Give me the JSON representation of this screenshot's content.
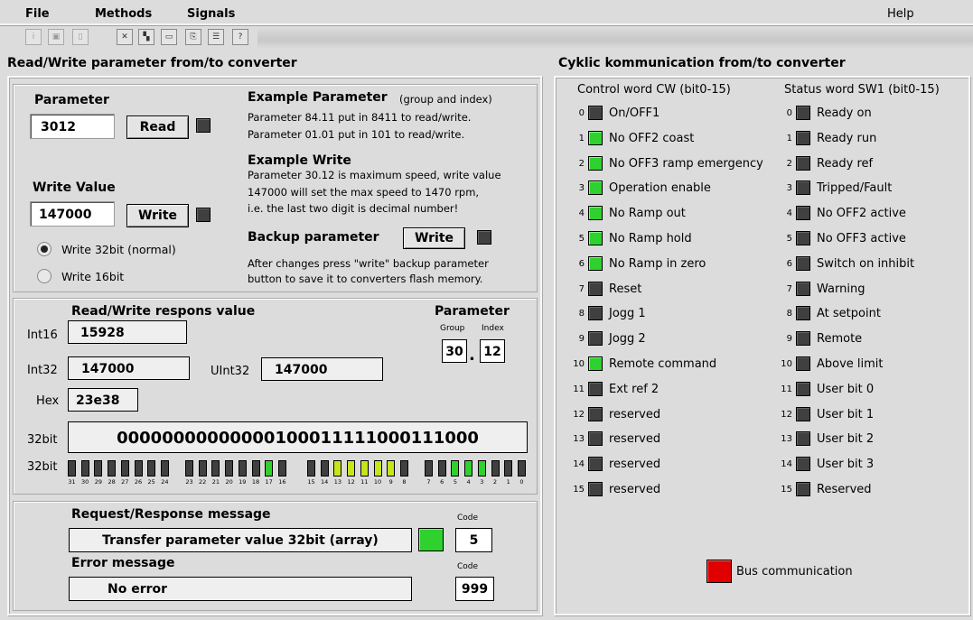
{
  "menu": {
    "file": "File",
    "methods": "Methods",
    "signals": "Signals",
    "help": "Help"
  },
  "toolbar": [
    {
      "icon": "info-icon",
      "glyph": "i"
    },
    {
      "icon": "image-icon",
      "glyph": "▣"
    },
    {
      "icon": "document-icon",
      "glyph": "▯"
    },
    {
      "icon": "cut-icon",
      "glyph": "✕"
    },
    {
      "icon": "block-icon",
      "glyph": "▚"
    },
    {
      "icon": "frame-icon",
      "glyph": "▭"
    },
    {
      "icon": "copy-icon",
      "glyph": "⎘"
    },
    {
      "icon": "list-icon",
      "glyph": "☰"
    },
    {
      "icon": "help-icon",
      "glyph": "?"
    }
  ],
  "left": {
    "title": "Read/Write parameter from/to converter",
    "parameter_label": "Parameter",
    "parameter_value": "3012",
    "read_label": "Read",
    "write_value_label": "Write Value",
    "write_value": "147000",
    "write_label": "Write",
    "radio_32": "Write 32bit (normal)",
    "radio_16": "Write 16bit",
    "example_param_title": "Example Parameter",
    "example_param_sub": "(group and index)",
    "example_param_l1": "Parameter 84.11 put in 8411 to read/write.",
    "example_param_l2": "Parameter 01.01 put in 101 to read/write.",
    "example_write_title": "Example Write",
    "example_write_l1": "Parameter 30.12 is maximum speed, write value",
    "example_write_l2": "147000 will set the max speed to 1470 rpm,",
    "example_write_l3": "i.e. the last two digit is decimal number!",
    "backup_title": "Backup parameter",
    "backup_button": "Write",
    "backup_l1": "After changes press \"write\" backup parameter",
    "backup_l2": "button to save it to converters flash memory."
  },
  "response": {
    "title": "Read/Write respons value",
    "int16_label": "Int16",
    "int16": "15928",
    "int32_label": "Int32",
    "int32": "147000",
    "uint32_label": "UInt32",
    "uint32": "147000",
    "hex_label": "Hex",
    "hex": "23e38",
    "bin_label": "32bit",
    "bin": "00000000000000100011111000111000",
    "bits_label": "32bit",
    "param_title": "Parameter",
    "group_label": "Group",
    "index_label": "Index",
    "group": "30",
    "index": "12",
    "dot": "."
  },
  "bits": [
    {
      "n": "31",
      "s": "off"
    },
    {
      "n": "30",
      "s": "off"
    },
    {
      "n": "29",
      "s": "off"
    },
    {
      "n": "28",
      "s": "off"
    },
    {
      "n": "27",
      "s": "off"
    },
    {
      "n": "26",
      "s": "off"
    },
    {
      "n": "25",
      "s": "off"
    },
    {
      "n": "24",
      "s": "off"
    },
    {
      "n": "23",
      "s": "off"
    },
    {
      "n": "22",
      "s": "off"
    },
    {
      "n": "21",
      "s": "off"
    },
    {
      "n": "20",
      "s": "off"
    },
    {
      "n": "19",
      "s": "off"
    },
    {
      "n": "18",
      "s": "off"
    },
    {
      "n": "17",
      "s": "on"
    },
    {
      "n": "16",
      "s": "off"
    },
    {
      "n": "15",
      "s": "off"
    },
    {
      "n": "14",
      "s": "off"
    },
    {
      "n": "13",
      "s": "yel"
    },
    {
      "n": "12",
      "s": "yel"
    },
    {
      "n": "11",
      "s": "yel"
    },
    {
      "n": "10",
      "s": "yel"
    },
    {
      "n": "9",
      "s": "yel"
    },
    {
      "n": "8",
      "s": "off"
    },
    {
      "n": "7",
      "s": "off"
    },
    {
      "n": "6",
      "s": "off"
    },
    {
      "n": "5",
      "s": "on"
    },
    {
      "n": "4",
      "s": "on"
    },
    {
      "n": "3",
      "s": "on"
    },
    {
      "n": "2",
      "s": "off"
    },
    {
      "n": "1",
      "s": "off"
    },
    {
      "n": "0",
      "s": "off"
    }
  ],
  "message": {
    "req_title": "Request/Response message",
    "req_text": "Transfer parameter value 32bit (array)",
    "code_label": "Code",
    "code": "5",
    "err_title": "Error message",
    "err_text": "No error",
    "err_code_label": "Code",
    "err_code": "999"
  },
  "right": {
    "title": "Cyklic kommunication from/to converter",
    "cw_title": "Control word CW (bit0-15)",
    "sw_title": "Status word SW1 (bit0-15)",
    "bus_label": "Bus communication"
  },
  "cw": [
    {
      "n": "0",
      "t": "On/OFF1",
      "on": false
    },
    {
      "n": "1",
      "t": "No OFF2 coast",
      "on": true
    },
    {
      "n": "2",
      "t": "No OFF3 ramp emergency",
      "on": true
    },
    {
      "n": "3",
      "t": "Operation enable",
      "on": true
    },
    {
      "n": "4",
      "t": "No Ramp out",
      "on": true
    },
    {
      "n": "5",
      "t": "No Ramp hold",
      "on": true
    },
    {
      "n": "6",
      "t": "No Ramp in zero",
      "on": true
    },
    {
      "n": "7",
      "t": "Reset",
      "on": false
    },
    {
      "n": "8",
      "t": "Jogg 1",
      "on": false
    },
    {
      "n": "9",
      "t": "Jogg 2",
      "on": false
    },
    {
      "n": "10",
      "t": "Remote command",
      "on": true
    },
    {
      "n": "11",
      "t": "Ext ref 2",
      "on": false
    },
    {
      "n": "12",
      "t": "reserved",
      "on": false
    },
    {
      "n": "13",
      "t": "reserved",
      "on": false
    },
    {
      "n": "14",
      "t": "reserved",
      "on": false
    },
    {
      "n": "15",
      "t": "reserved",
      "on": false
    }
  ],
  "sw": [
    {
      "n": "0",
      "t": "Ready on",
      "on": false
    },
    {
      "n": "1",
      "t": "Ready run",
      "on": false
    },
    {
      "n": "2",
      "t": "Ready ref",
      "on": false
    },
    {
      "n": "3",
      "t": "Tripped/Fault",
      "on": false
    },
    {
      "n": "4",
      "t": "No OFF2 active",
      "on": false
    },
    {
      "n": "5",
      "t": "No OFF3 active",
      "on": false
    },
    {
      "n": "6",
      "t": "Switch on inhibit",
      "on": false
    },
    {
      "n": "7",
      "t": "Warning",
      "on": false
    },
    {
      "n": "8",
      "t": "At setpoint",
      "on": false
    },
    {
      "n": "9",
      "t": "Remote",
      "on": false
    },
    {
      "n": "10",
      "t": "Above limit",
      "on": false
    },
    {
      "n": "11",
      "t": "User bit 0",
      "on": false
    },
    {
      "n": "12",
      "t": "User bit 1",
      "on": false
    },
    {
      "n": "13",
      "t": "User bit 2",
      "on": false
    },
    {
      "n": "14",
      "t": "User bit 3",
      "on": false
    },
    {
      "n": "15",
      "t": "Reserved",
      "on": false
    }
  ]
}
